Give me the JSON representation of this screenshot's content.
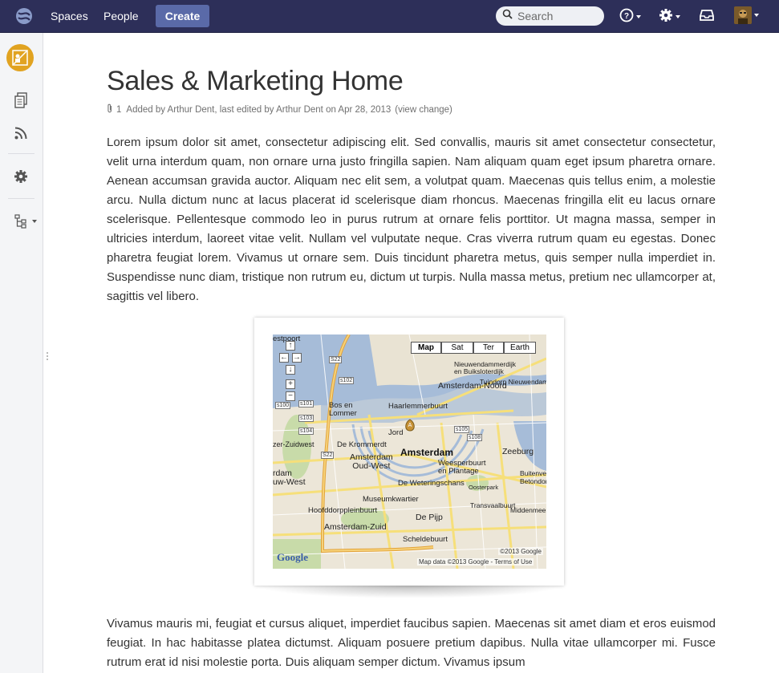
{
  "nav": {
    "spaces": "Spaces",
    "people": "People",
    "create": "Create",
    "search_placeholder": "Search"
  },
  "page": {
    "title": "Sales & Marketing Home",
    "attachment_count": "1",
    "meta": "Added by Arthur Dent, last edited by Arthur Dent on Apr 28, 2013",
    "view_change": "(view change)",
    "para1": "Lorem ipsum dolor sit amet, consectetur adipiscing elit. Sed convallis, mauris sit amet consectetur consectetur, velit urna interdum quam, non ornare urna justo fringilla sapien. Nam aliquam quam eget ipsum pharetra ornare. Aenean accumsan gravida auctor. Aliquam nec elit sem, a volutpat quam. Maecenas quis tellus enim, a molestie arcu. Nulla dictum nunc at lacus placerat id scelerisque diam rhoncus. Maecenas fringilla elit eu lacus ornare scelerisque. Pellentesque commodo leo in purus rutrum at ornare felis porttitor. Ut magna massa, semper in ultricies interdum, laoreet vitae velit. Nullam vel vulputate neque. Cras viverra rutrum quam eu egestas. Donec pharetra feugiat lorem. Vivamus ut ornare sem. Duis tincidunt pharetra metus, quis semper nulla imperdiet in. Suspendisse nunc diam, tristique non rutrum eu, dictum ut turpis. Nulla massa metus, pretium nec ullamcorper at, sagittis vel libero.",
    "para2": "Vivamus mauris mi, feugiat et cursus aliquet, imperdiet faucibus sapien. Maecenas sit amet diam et eros euismod feugiat. In hac habitasse platea dictumst. Aliquam posuere pretium dapibus. Nulla vitae ullamcorper mi. Fusce rutrum erat id nisi molestie porta. Duis aliquam semper dictum. Vivamus ipsum"
  },
  "map": {
    "types": [
      "Map",
      "Sat",
      "Ter",
      "Earth"
    ],
    "labels": {
      "westpoort": "estpoort",
      "noord_bui": "Nieuwendammerdijk\nen Buiksloterdijk",
      "tuindorp": "Tuindorp Nieuwendam",
      "noord": "Amsterdam-Noord",
      "bos": "Bos en\nLommer",
      "haarlemmer": "Haarlemmerbuurt",
      "jordaan": "Jord",
      "zuidwest_zee": "zer-Zuidwest",
      "krommerdt": "De Krommerdt",
      "amsterdam": "Amsterdam",
      "zeeburg": "Zeeburg",
      "oudwest": "Amsterdam\nOud-West",
      "weesperbuurt": "Weesperbuurt\nen Plantage",
      "nieuwwest": "rdam\nuw-West",
      "weteringschans": "De Weteringschans",
      "oosterpark": "Oosterpark",
      "betondorp": "Buitenveldert\nBetondorp",
      "museumkwartier": "Museumkwartier",
      "transvaalbuurt": "Transvaalbuurt",
      "hoofddorp": "Hoofddorppleinbuurt",
      "pijp": "De Pijp",
      "middenmeer": "Middenmeer",
      "zuid": "Amsterdam-Zuid",
      "scheldebuurt": "Scheldebuurt"
    },
    "roads": [
      "S22",
      "S102",
      "S101",
      "S103",
      "S104",
      "S100",
      "S105",
      "S108",
      "S22b"
    ],
    "road_labels": [
      "S22",
      "s102",
      "s101",
      "s103",
      "s104",
      "s100",
      "s105",
      "s108",
      "S22"
    ],
    "copyright": "©2013 Google",
    "footer": "Map data ©2013 Google - Terms of Use",
    "logo": "Google"
  }
}
